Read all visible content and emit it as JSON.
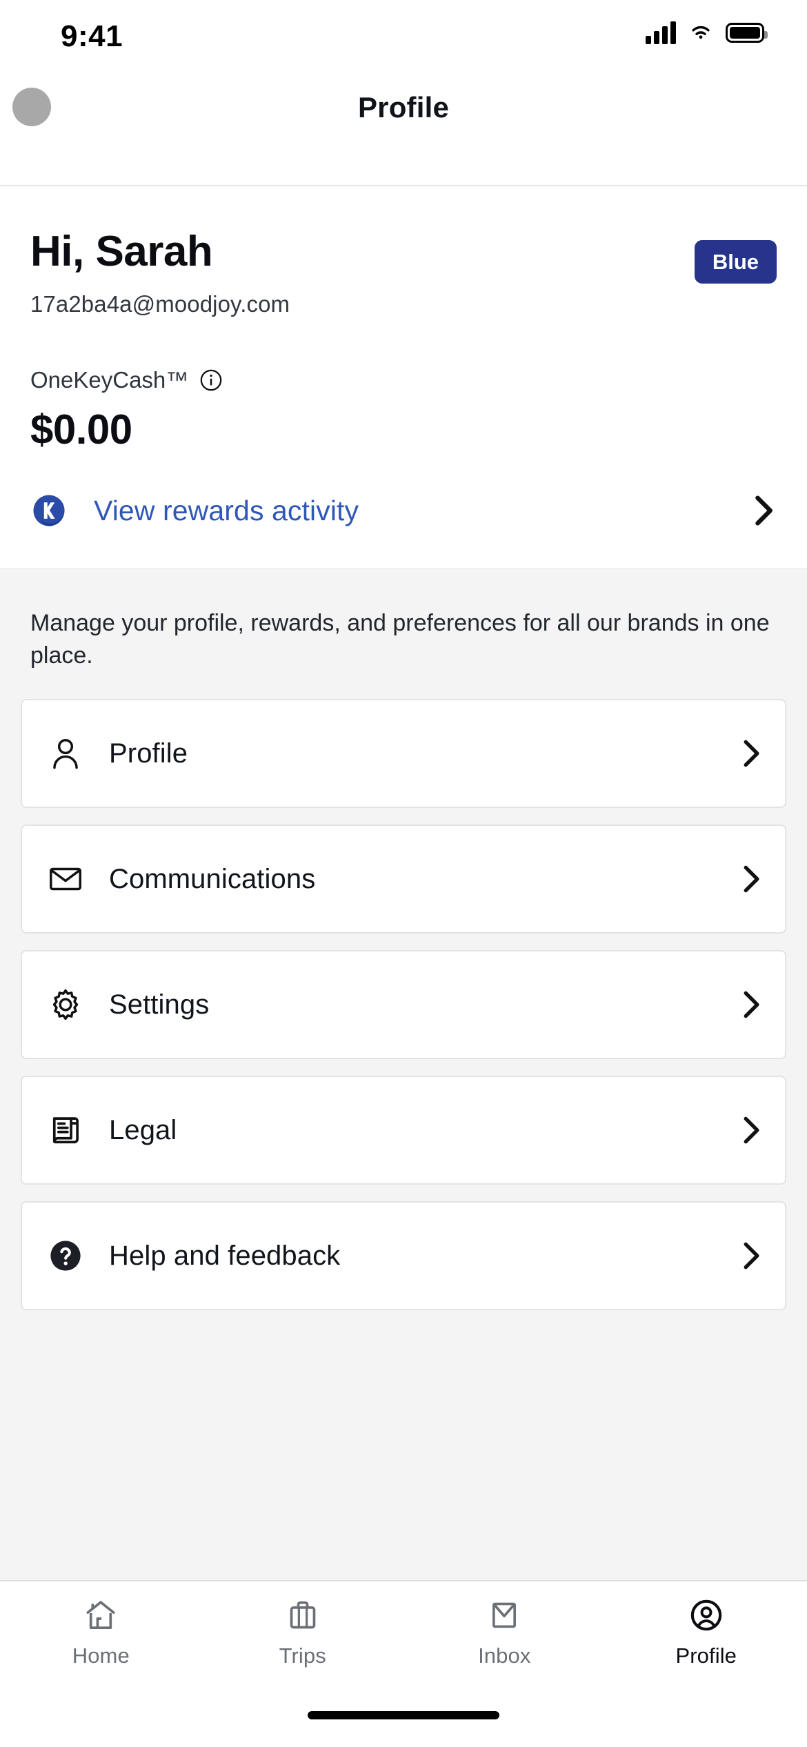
{
  "status_bar": {
    "time": "9:41",
    "signal_icon": "cellular-signal-icon",
    "wifi_icon": "wifi-icon",
    "battery_icon": "battery-full-icon"
  },
  "header": {
    "title": "Profile",
    "avatar_name": "user-avatar"
  },
  "account": {
    "greeting": "Hi, Sarah",
    "email": "17a2ba4a@moodjoy.com",
    "tier_badge": "Blue",
    "tier_badge_color": "#26348b",
    "rewards_label": "OneKeyCash™",
    "info_icon": "info-circle-icon",
    "rewards_amount": "$0.00",
    "rewards_link": "View rewards activity",
    "rewards_link_color": "#2f57b8",
    "rewards_logo_icon": "onekey-logo-icon",
    "chevron_icon": "chevron-right-icon"
  },
  "menu": {
    "blurb": "Manage your profile, rewards, and preferences for all our brands in one place.",
    "items": [
      {
        "label": "Profile",
        "icon": "person-icon"
      },
      {
        "label": "Communications",
        "icon": "envelope-icon"
      },
      {
        "label": "Settings",
        "icon": "gear-icon"
      },
      {
        "label": "Legal",
        "icon": "scroll-document-icon"
      },
      {
        "label": "Help and feedback",
        "icon": "question-mark-circle-icon"
      }
    ]
  },
  "tabbar": {
    "tabs": [
      {
        "label": "Home",
        "icon": "house-icon",
        "active": false
      },
      {
        "label": "Trips",
        "icon": "suitcase-icon",
        "active": false
      },
      {
        "label": "Inbox",
        "icon": "envelope-icon",
        "active": false
      },
      {
        "label": "Profile",
        "icon": "person-circle-icon",
        "active": true
      }
    ]
  }
}
